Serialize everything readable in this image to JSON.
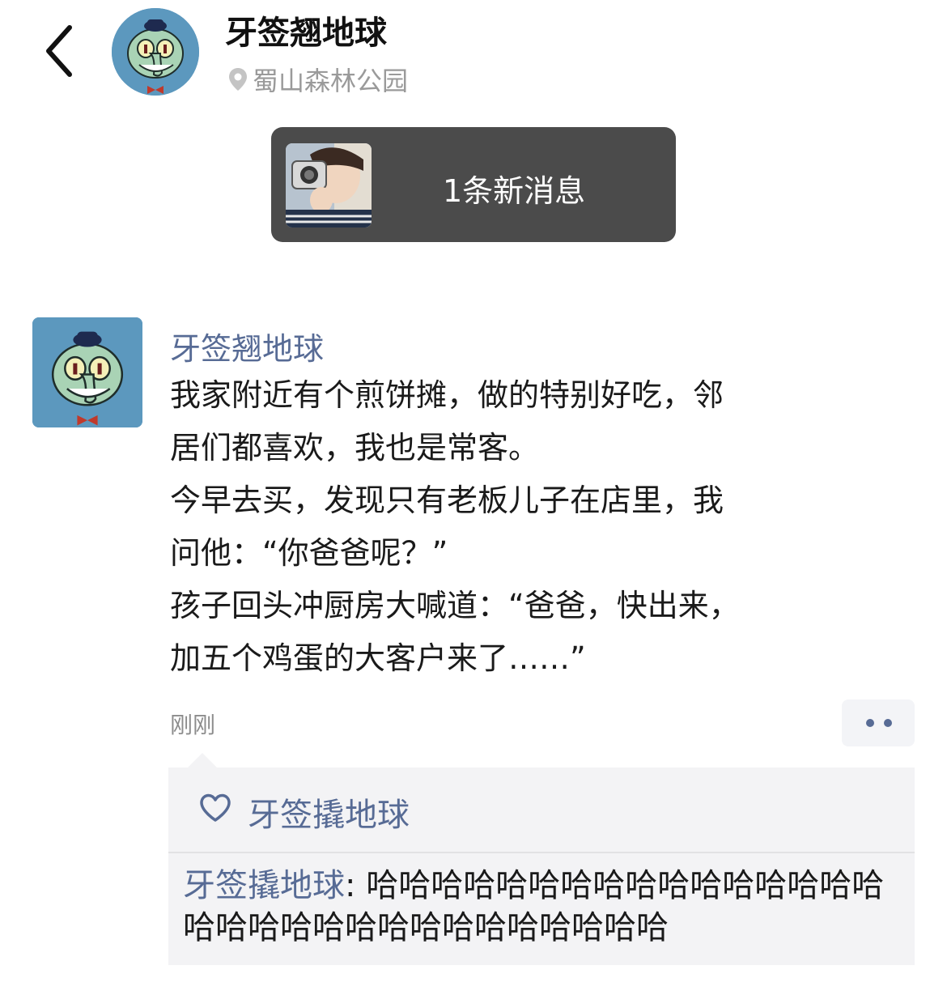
{
  "header": {
    "title": "牙签翘地球",
    "location": "蜀山森林公园",
    "icons": {
      "back": "chevron-left-icon",
      "location": "location-pin-icon"
    }
  },
  "banner": {
    "text": "1条新消息"
  },
  "post": {
    "author": "牙签翘地球",
    "lines": [
      "我家附近有个煎饼摊，做的特别好吃，邻",
      "居们都喜欢，我也是常客。",
      "今早去买，发现只有老板儿子在店里，我",
      "问他：“你爸爸呢？”",
      "孩子回头冲厨房大喊道：“爸爸，快出来，",
      "加五个鸡蛋的大客户来了……”"
    ],
    "time": "刚刚"
  },
  "likes": {
    "names": [
      "牙签撬地球"
    ]
  },
  "comments": [
    {
      "author": "牙签撬地球",
      "separator": ": ",
      "text": "哈哈哈哈哈哈哈哈哈哈哈哈哈哈哈哈哈哈哈哈哈哈哈哈哈哈哈哈哈哈哈"
    }
  ],
  "colors": {
    "link": "#576b95",
    "banner_bg": "#4b4b4b",
    "avatar_bg": "#5c98be",
    "comment_bg": "#f3f3f5"
  }
}
